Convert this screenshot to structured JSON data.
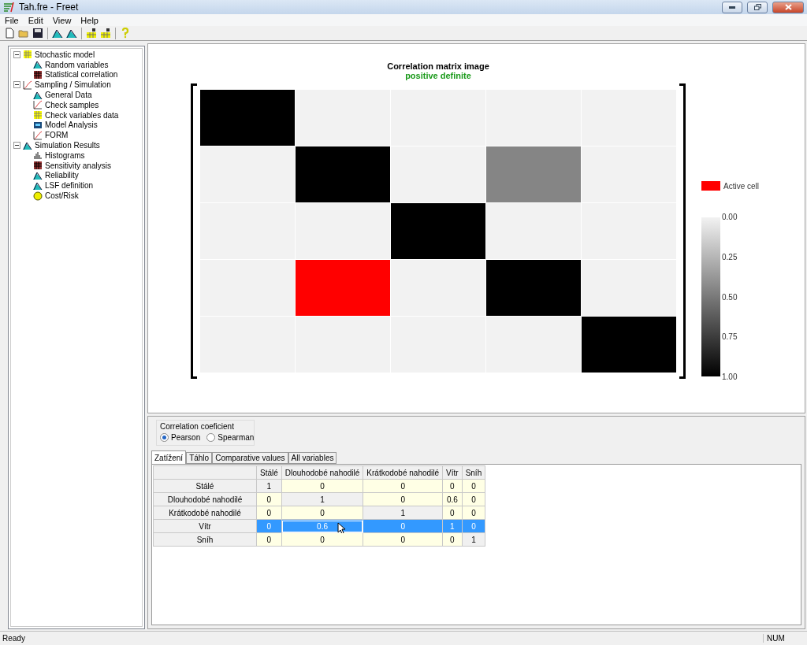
{
  "window": {
    "title": "Tah.fre - Freet"
  },
  "menu": [
    "File",
    "Edit",
    "View",
    "Help"
  ],
  "toolbar": [
    {
      "kind": "new"
    },
    {
      "kind": "open"
    },
    {
      "kind": "save"
    },
    {
      "kind": "sep"
    },
    {
      "kind": "curve"
    },
    {
      "kind": "curve"
    },
    {
      "kind": "sep"
    },
    {
      "kind": "grid"
    },
    {
      "kind": "grid"
    },
    {
      "kind": "sep"
    },
    {
      "kind": "help"
    }
  ],
  "tree": [
    {
      "label": "Stochastic model",
      "kind": "grid",
      "expanded": true,
      "children": [
        {
          "label": "Random variables",
          "kind": "curve"
        },
        {
          "label": "Statistical correlation",
          "kind": "matrix"
        }
      ]
    },
    {
      "label": "Sampling / Simulation",
      "kind": "line",
      "expanded": true,
      "children": [
        {
          "label": "General Data",
          "kind": "curve"
        },
        {
          "label": "Check samples",
          "kind": "line"
        },
        {
          "label": "Check variables data",
          "kind": "grid"
        },
        {
          "label": "Model Analysis",
          "kind": "screen"
        },
        {
          "label": "FORM",
          "kind": "line"
        }
      ]
    },
    {
      "label": "Simulation Results",
      "kind": "curve",
      "expanded": true,
      "children": [
        {
          "label": "Histograms",
          "kind": "bars"
        },
        {
          "label": "Sensitivity analysis",
          "kind": "matrix"
        },
        {
          "label": "Reliability",
          "kind": "curve"
        },
        {
          "label": "LSF definition",
          "kind": "curve"
        },
        {
          "label": "Cost/Risk",
          "kind": "coin"
        }
      ]
    }
  ],
  "chart": {
    "title": "Correlation matrix image",
    "status": "positive definite",
    "legend_active": "Active cell",
    "scale": [
      "0.00",
      "0.25",
      "0.50",
      "0.75",
      "1.00"
    ]
  },
  "coefficient": {
    "title": "Correlation coeficient",
    "options": [
      {
        "label": "Pearson",
        "selected": true
      },
      {
        "label": "Spearman",
        "selected": false
      }
    ]
  },
  "tabs": [
    {
      "label": "Zatížení",
      "selected": true
    },
    {
      "label": "Táhlo",
      "selected": false
    },
    {
      "label": "Comparative values",
      "selected": false
    },
    {
      "label": "All variables",
      "selected": false
    }
  ],
  "table": {
    "columns": [
      "Stálé",
      "Dlouhodobé nahodilé",
      "Krátkodobé nahodilé",
      "Vítr",
      "Sníh"
    ],
    "rows": [
      {
        "label": "Stálé",
        "selected": false,
        "cells": [
          {
            "value": "1",
            "active": false
          },
          {
            "value": "0",
            "active": false
          },
          {
            "value": "0",
            "active": false
          },
          {
            "value": "0",
            "active": false
          },
          {
            "value": "0",
            "active": false
          }
        ]
      },
      {
        "label": "Dlouhodobé nahodilé",
        "selected": false,
        "cells": [
          {
            "value": "0",
            "active": false
          },
          {
            "value": "1",
            "active": false
          },
          {
            "value": "0",
            "active": false
          },
          {
            "value": "0.6",
            "active": false
          },
          {
            "value": "0",
            "active": false
          }
        ]
      },
      {
        "label": "Krátkodobé nahodilé",
        "selected": false,
        "cells": [
          {
            "value": "0",
            "active": false
          },
          {
            "value": "0",
            "active": false
          },
          {
            "value": "1",
            "active": false
          },
          {
            "value": "0",
            "active": false
          },
          {
            "value": "0",
            "active": false
          }
        ]
      },
      {
        "label": "Vítr",
        "selected": true,
        "cells": [
          {
            "value": "0",
            "active": false
          },
          {
            "value": "0.6",
            "active": true
          },
          {
            "value": "0",
            "active": false
          },
          {
            "value": "1",
            "active": false
          },
          {
            "value": "0",
            "active": false
          }
        ]
      },
      {
        "label": "Sníh",
        "selected": false,
        "cells": [
          {
            "value": "0",
            "active": false
          },
          {
            "value": "0",
            "active": false
          },
          {
            "value": "0",
            "active": false
          },
          {
            "value": "0",
            "active": false
          },
          {
            "value": "1",
            "active": false
          }
        ]
      }
    ]
  },
  "status_bar": {
    "message": "Ready",
    "indicator": "NUM"
  }
}
